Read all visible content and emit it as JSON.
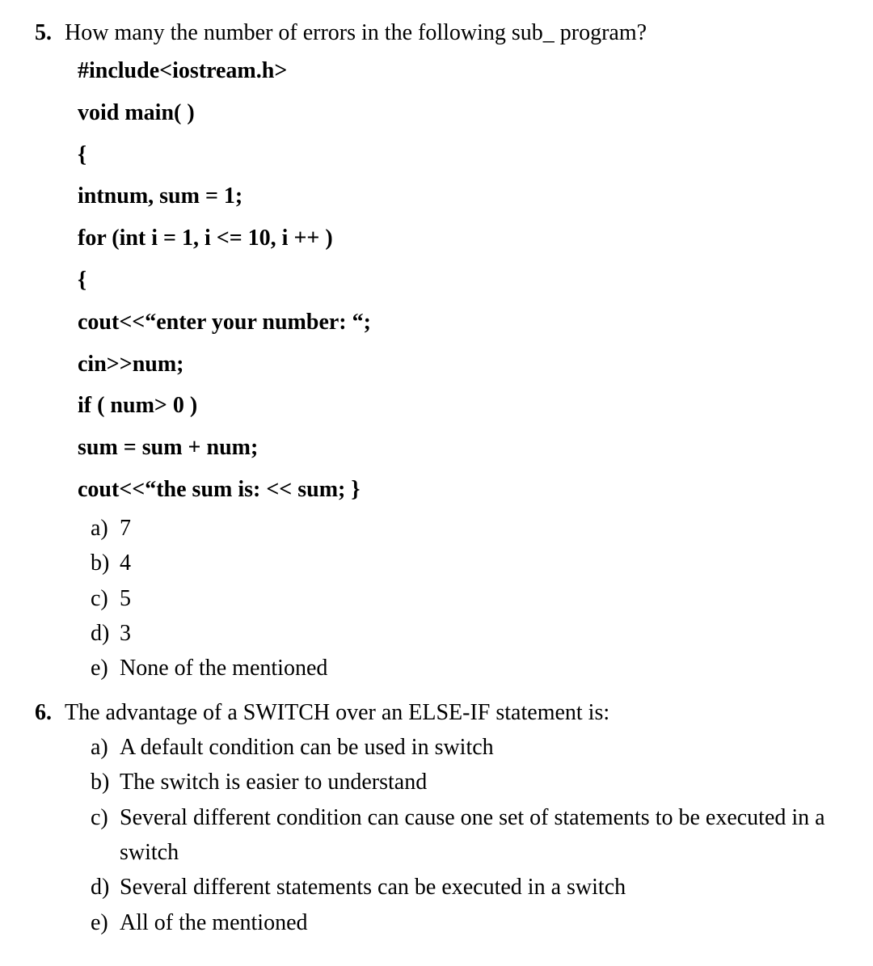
{
  "q5": {
    "number": "5.",
    "prompt": "How many the number of errors in the following sub_ program?",
    "code": [
      "#include<iostream.h>",
      "void main( )",
      "{",
      "intnum, sum = 1;",
      "for (int i = 1, i <= 10, i ++ )",
      "{",
      "cout<<“enter your number: “;",
      "cin>>num;",
      "if ( num> 0 )",
      "sum = sum + num;",
      "cout<<“the sum is: << sum; }"
    ],
    "options": [
      {
        "letter": "a)",
        "text": "7"
      },
      {
        "letter": "b)",
        "text": "4"
      },
      {
        "letter": "c)",
        "text": "5"
      },
      {
        "letter": "d)",
        "text": "3"
      },
      {
        "letter": "e)",
        "text": "None of the mentioned"
      }
    ]
  },
  "q6": {
    "number": "6.",
    "prompt": "The advantage of a SWITCH over an ELSE-IF statement is:",
    "options": [
      {
        "letter": "a)",
        "text": "A default condition can be used in switch"
      },
      {
        "letter": "b)",
        "text": "The switch is easier to understand"
      },
      {
        "letter": "c)",
        "text": "Several different condition can cause one set of statements to be executed in a switch"
      },
      {
        "letter": "d)",
        "text": "Several different statements can be executed in a switch"
      },
      {
        "letter": "e)",
        "text": "All of the mentioned"
      }
    ]
  }
}
